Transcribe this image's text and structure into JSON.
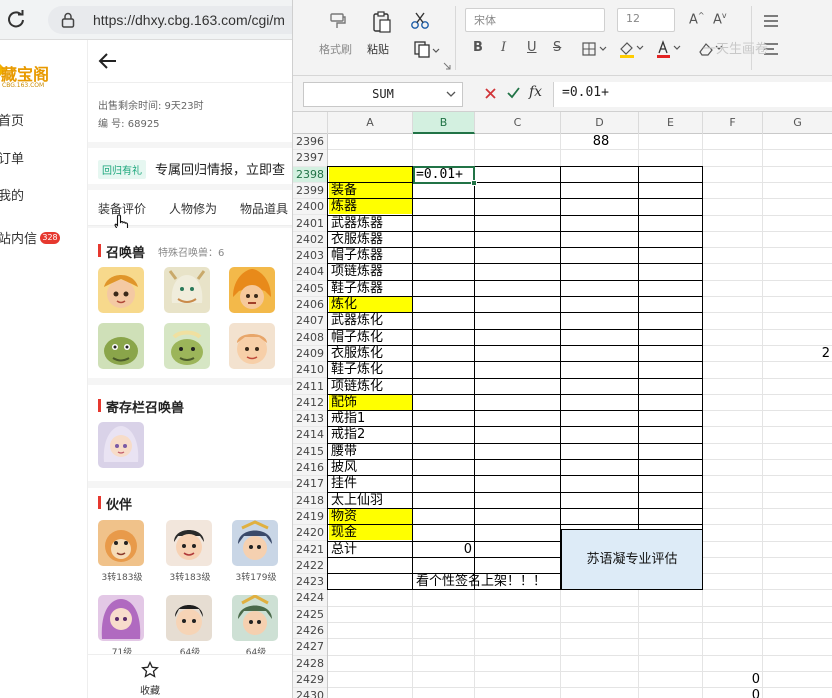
{
  "browser": {
    "url": "https://dhxy.cbg.163.com/cgi/m",
    "logo_text": "藏宝阁",
    "logo_sub": "CBG.163.COM",
    "nav": [
      {
        "label": "首页"
      },
      {
        "label": "订单"
      },
      {
        "label": "我的"
      },
      {
        "label": "站内信"
      }
    ],
    "nav_badge": "328",
    "meta": {
      "sale_time": "出售剩余时间: 9天23时",
      "serial": "编 号: 68925"
    },
    "promo": {
      "tag": "回归有礼",
      "text": "专属回归情报，立即查"
    },
    "tabs": [
      "装备评价",
      "人物修为",
      "物品道具"
    ],
    "summon": {
      "title": "召唤兽",
      "special": "特殊召唤兽：6"
    },
    "storage_title": "寄存栏召唤兽",
    "partner": {
      "title": "伙伴",
      "levels": [
        "3转183级",
        "3转183级",
        "3转179级",
        "71级",
        "64级",
        "64级"
      ]
    },
    "collect_label": "收藏"
  },
  "excel": {
    "ribbon": {
      "format_painter": "格式刷",
      "paste": "粘贴",
      "font_name": "宋体",
      "font_size": "12",
      "watermark": "一天生画卷"
    },
    "name_box": "SUM",
    "formula": "=0.01+",
    "columns": [
      "A",
      "B",
      "C",
      "D",
      "E",
      "F",
      "G"
    ],
    "rows": [
      "2396",
      "2397",
      "2398",
      "2399",
      "2400",
      "2401",
      "2402",
      "2403",
      "2404",
      "2405",
      "2406",
      "2407",
      "2408",
      "2409",
      "2410",
      "2411",
      "2412",
      "2413",
      "2414",
      "2415",
      "2416",
      "2417",
      "2418",
      "2419",
      "2420",
      "2421",
      "2422",
      "2423",
      "2424",
      "2425",
      "2426",
      "2427",
      "2428",
      "2429",
      "2430"
    ],
    "cells": {
      "d2396": "88",
      "b2398": "=0.01+",
      "a2399": "装备",
      "a2400": "炼器",
      "a2401": "武器炼器",
      "a2402": "衣服炼器",
      "a2403": "帽子炼器",
      "a2404": "项链炼器",
      "a2405": "鞋子炼器",
      "a2406": "炼化",
      "a2407": "武器炼化",
      "a2408": "帽子炼化",
      "a2409": "衣服炼化",
      "a2410": "鞋子炼化",
      "a2411": "项链炼化",
      "a2412": "配饰",
      "a2413": "戒指1",
      "a2414": "戒指2",
      "a2415": "腰带",
      "a2416": "披风",
      "a2417": "挂件",
      "a2418": "太上仙羽",
      "a2419": "物资",
      "a2420": "现金",
      "a2421": "总计",
      "b2421": "0",
      "b2423": "看个性签名上架！！！",
      "merged": "苏语凝专业评估",
      "g2409": "2",
      "f2429": "0",
      "f2430": "0"
    }
  },
  "colors": {
    "yellow": "#ffff00",
    "merged_fill": "#ddebf7",
    "excel_green": "#217346",
    "badge_red": "#e6382f"
  }
}
